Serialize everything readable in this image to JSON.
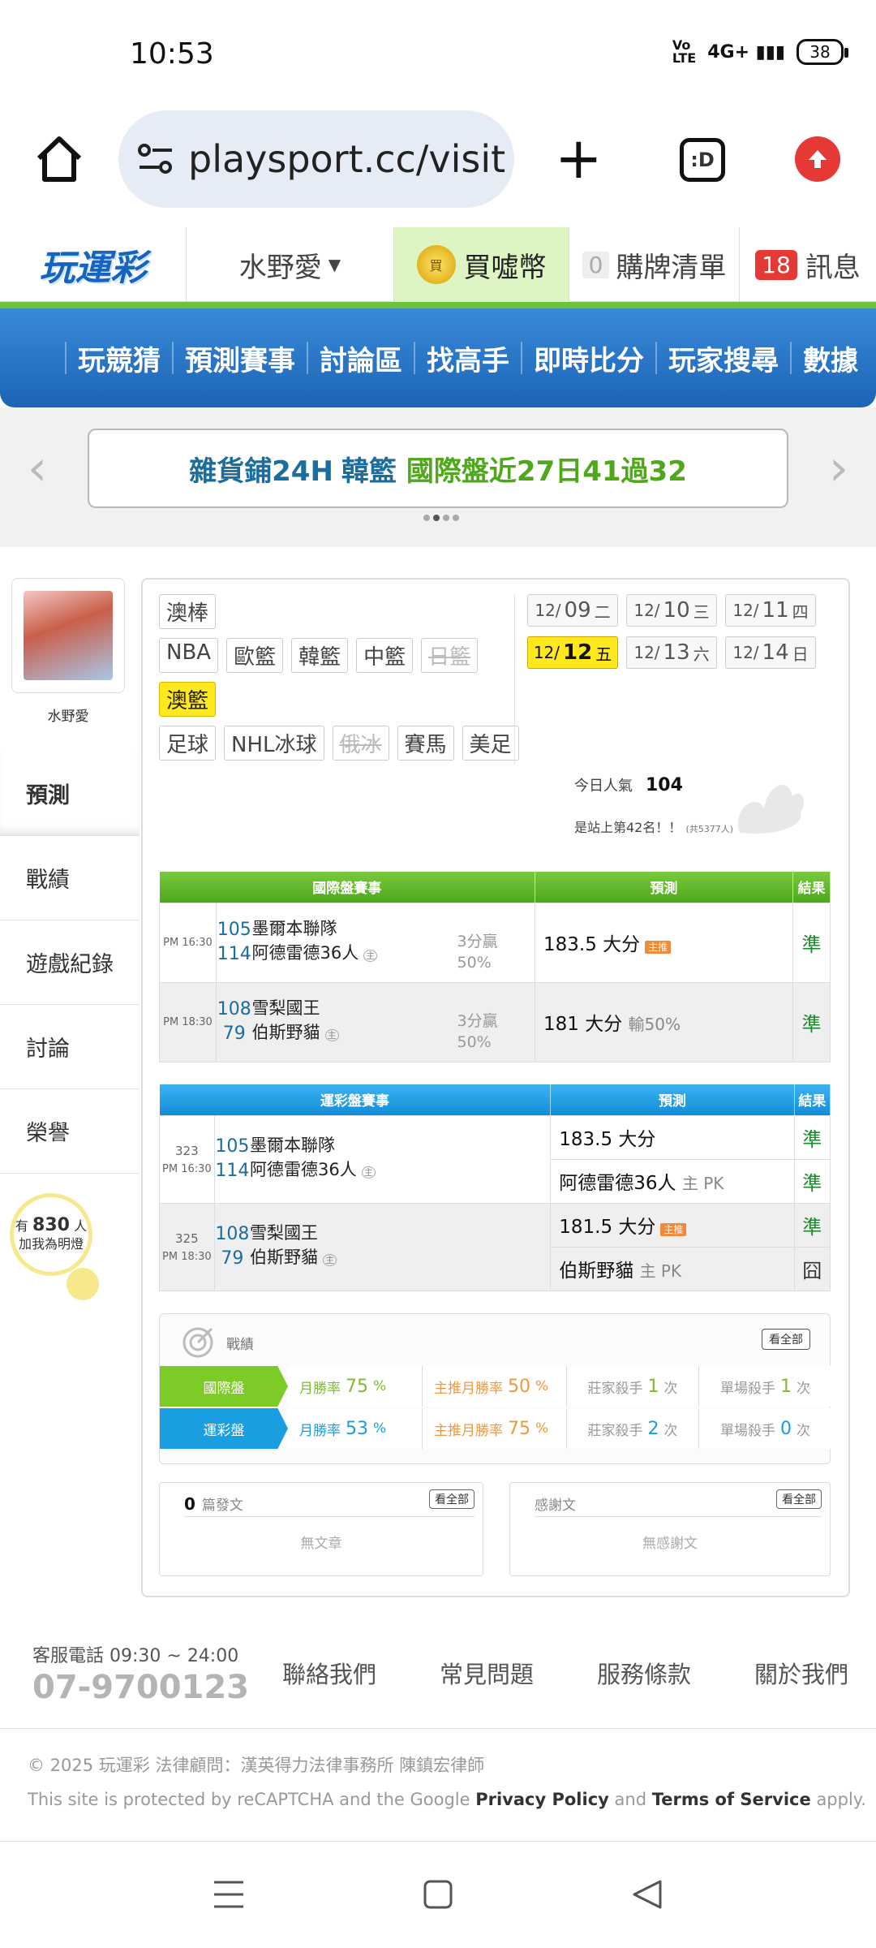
{
  "status": {
    "time": "10:53",
    "network": "4G+",
    "battery": "38"
  },
  "browser": {
    "url": "playsport.cc/visit",
    "tab_label": ":D"
  },
  "header": {
    "logo": "玩運彩",
    "user": "水野愛",
    "coin_icon_text": "買",
    "coin": "買噓幣",
    "cart_count": "0",
    "cart": "購牌清單",
    "msg_count": "18",
    "msg": "訊息"
  },
  "nav": [
    "玩競猜",
    "預測賽事",
    "討論區",
    "找高手",
    "即時比分",
    "玩家搜尋",
    "數據"
  ],
  "banner": {
    "part1": "雜貨鋪24H",
    "part2": "韓籃",
    "part3": "國際盤近27日41過32"
  },
  "sidebar": {
    "username": "水野愛",
    "tabs": [
      "預測",
      "戰績",
      "遊戲紀錄",
      "討論",
      "榮譽"
    ],
    "fans_prefix": "有",
    "fans": "830",
    "fans_unit": "人",
    "fans_suffix": "加我為明燈"
  },
  "filters": {
    "row1": [
      "澳棒"
    ],
    "row2": [
      "NBA",
      "歐籃",
      "韓籃",
      "中籃",
      "日籃"
    ],
    "row3": [
      "澳籃"
    ],
    "row4": [
      "足球",
      "NHL冰球",
      "俄冰",
      "賽馬",
      "美足"
    ]
  },
  "dates": [
    {
      "m": "12/",
      "d": "09",
      "w": "二"
    },
    {
      "m": "12/",
      "d": "10",
      "w": "三"
    },
    {
      "m": "12/",
      "d": "11",
      "w": "四"
    },
    {
      "m": "12/",
      "d": "12",
      "w": "五"
    },
    {
      "m": "12/",
      "d": "13",
      "w": "六"
    },
    {
      "m": "12/",
      "d": "14",
      "w": "日"
    }
  ],
  "popularity": {
    "label": "今日人氣",
    "value": "104",
    "rank": "是站上第42名！！",
    "rank_note": "(共5377人)"
  },
  "intl": {
    "headers": [
      "國際盤賽事",
      "預測",
      "結果"
    ],
    "games": [
      {
        "time": "PM 16:30",
        "s1": "105",
        "t1": "墨爾本聯隊",
        "s2": "114",
        "t2": "阿德雷德36人",
        "home": "主",
        "win": "3分贏",
        "pct": "50%",
        "pred": "183.5 大分",
        "tag": "主推",
        "sub": "",
        "res": "準"
      },
      {
        "time": "PM 18:30",
        "s1": "108",
        "t1": "雪梨國王",
        "s2": "79",
        "t2": "伯斯野貓",
        "home": "主",
        "win": "3分贏",
        "pct": "50%",
        "pred": "181 大分",
        "tag": "",
        "sub": "輸50%",
        "res": "準"
      }
    ]
  },
  "lottery": {
    "headers": [
      "運彩盤賽事",
      "預測",
      "結果"
    ],
    "games": [
      {
        "no": "323",
        "time": "PM 16:30",
        "s1": "105",
        "t1": "墨爾本聯隊",
        "s2": "114",
        "t2": "阿德雷德36人",
        "home": "主",
        "p1": "183.5 大分",
        "p1tag": "",
        "r1": "準",
        "p2": "阿德雷德36人",
        "p2sub": "主 PK",
        "r2": "準"
      },
      {
        "no": "325",
        "time": "PM 18:30",
        "s1": "108",
        "t1": "雪梨國王",
        "s2": "79",
        "t2": "伯斯野貓",
        "home": "主",
        "p1": "181.5 大分",
        "p1tag": "主推",
        "r1": "準",
        "p2": "伯斯野貓",
        "p2sub": "主 PK",
        "r2": "囧"
      }
    ]
  },
  "stats": {
    "title": "戰績",
    "view_all": "看全部",
    "rows": [
      {
        "label": "國際盤",
        "m_label": "月勝率",
        "m": "75",
        "pct": "%",
        "mm_label": "主推月勝率",
        "mm": "50",
        "k_label": "莊家殺手",
        "k": "1",
        "unit": "次",
        "s_label": "單場殺手",
        "s": "1"
      },
      {
        "label": "運彩盤",
        "m_label": "月勝率",
        "m": "53",
        "pct": "%",
        "mm_label": "主推月勝率",
        "mm": "75",
        "k_label": "莊家殺手",
        "k": "2",
        "unit": "次",
        "s_label": "單場殺手",
        "s": "0"
      }
    ]
  },
  "posts": {
    "count": "0",
    "label": "篇發文",
    "view_all": "看全部",
    "empty": "無文章"
  },
  "thanks": {
    "label": "感謝文",
    "view_all": "看全部",
    "empty": "無感謝文"
  },
  "footer": {
    "tel_label": "客服電話 09:30 ~ 24:00",
    "tel": "07-9700123",
    "links": [
      "聯絡我們",
      "常見問題",
      "服務條款",
      "關於我們"
    ]
  },
  "copyright": {
    "line1": "© 2025 玩運彩 法律顧問：漢英得力法律事務所 陳鎮宏律師",
    "pre": "This site is protected by reCAPTCHA and the Google",
    "pp": "Privacy Policy",
    "and": "and",
    "tos": "Terms of Service",
    "post": "apply."
  },
  "colors": {
    "green": "#5ab423",
    "blue": "#1a9ee2",
    "nav": "#1f6fc0",
    "yellow": "#ffe81c"
  }
}
